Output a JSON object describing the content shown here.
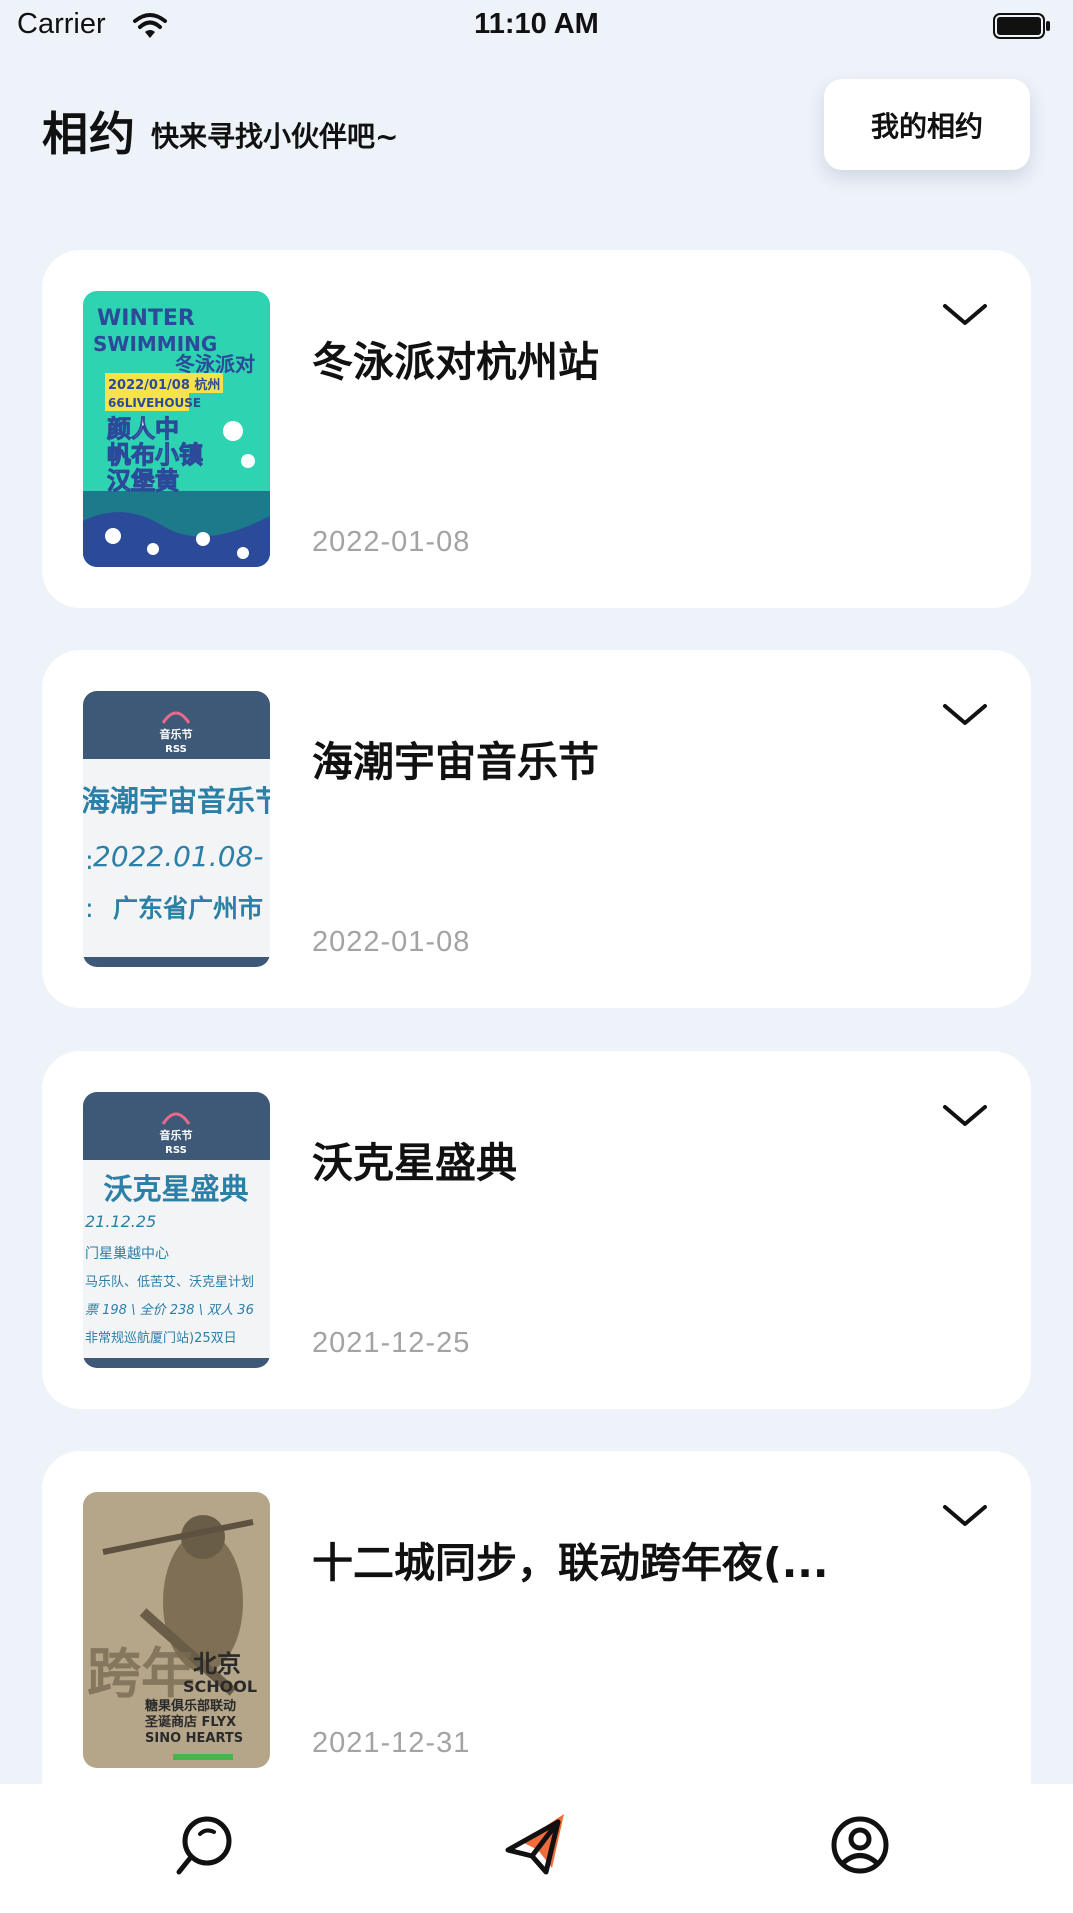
{
  "status_bar": {
    "carrier": "Carrier",
    "time": "11:10 AM"
  },
  "header": {
    "title": "相约",
    "subtitle": "快来寻找小伙伴吧~",
    "my_button_label": "我的相约"
  },
  "events": [
    {
      "title": "冬泳派对杭州站",
      "date": "2022-01-08",
      "poster_lines": [
        "WINTER",
        "SWIMMING",
        "冬泳派对",
        "2022/01/08 杭州",
        "66LIVEHOUSE",
        "颜人中",
        "帆布小镇",
        "汉堡黄"
      ]
    },
    {
      "title": "海潮宇宙音乐节",
      "date": "2022-01-08",
      "poster_lines": [
        "音乐节",
        "RSS",
        "海潮宇宙音乐节",
        "2022.01.08-",
        "广东省广州市"
      ]
    },
    {
      "title": "沃克星盛典",
      "date": "2021-12-25",
      "poster_lines": [
        "音乐节",
        "RSS",
        "沃克星盛典",
        "21.12.25",
        "门星巢越中心",
        "马乐队、低苦艾、沃克星计划",
        "票 198 \\ 全价 238 \\ 双人 36",
        "非常规巡航厦门站)25双日"
      ]
    },
    {
      "title": "十二城同步，联动跨年夜(...",
      "date": "2021-12-31",
      "poster_lines": [
        "跨年",
        "北京",
        "SCHOOL",
        "糖果俱乐部联动",
        "圣诞商店 FLYX",
        "SINO HEARTS"
      ]
    }
  ],
  "tab_bar": {
    "items": [
      "search-icon",
      "send-icon",
      "profile-icon"
    ],
    "active": "send-icon",
    "accent": "#f26b3a"
  },
  "colors": {
    "background": "#eef2f9",
    "card": "#ffffff",
    "date": "#a3a3a3",
    "poster_navy": "#3e5878",
    "poster_teal": "#2ed3b2"
  }
}
